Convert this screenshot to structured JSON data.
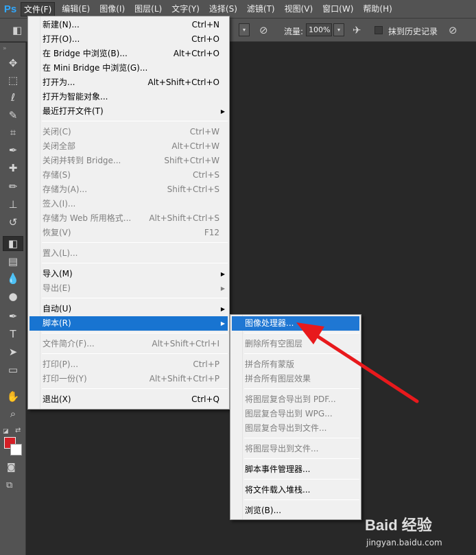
{
  "app": {
    "logo": "Ps"
  },
  "menubar": [
    {
      "label": "文件(F)",
      "active": true
    },
    {
      "label": "编辑(E)"
    },
    {
      "label": "图像(I)"
    },
    {
      "label": "图层(L)"
    },
    {
      "label": "文字(Y)"
    },
    {
      "label": "选择(S)"
    },
    {
      "label": "滤镜(T)"
    },
    {
      "label": "视图(V)"
    },
    {
      "label": "窗口(W)"
    },
    {
      "label": "帮助(H)"
    }
  ],
  "options_bar": {
    "flow_label": "流量:",
    "flow_value": "100%",
    "history_label": "抹到历史记录",
    "history_checked": false
  },
  "tools": {
    "grip": "»",
    "items": [
      {
        "name": "move-tool-icon",
        "glyph": "✥"
      },
      {
        "name": "marquee-tool-icon",
        "glyph": "⬚"
      },
      {
        "name": "lasso-tool-icon",
        "glyph": "ℓ"
      },
      {
        "name": "quick-select-tool-icon",
        "glyph": "✎"
      },
      {
        "name": "crop-tool-icon",
        "glyph": "⌗"
      },
      {
        "name": "eyedropper-tool-icon",
        "glyph": "✒"
      },
      {
        "name": "healing-brush-tool-icon",
        "glyph": "✚"
      },
      {
        "name": "brush-tool-icon",
        "glyph": "✏"
      },
      {
        "name": "clone-stamp-tool-icon",
        "glyph": "⊥"
      },
      {
        "name": "history-brush-tool-icon",
        "glyph": "↺"
      },
      {
        "name": "eraser-tool-icon",
        "glyph": "◧",
        "selected": true
      },
      {
        "name": "gradient-tool-icon",
        "glyph": "▤"
      },
      {
        "name": "blur-tool-icon",
        "glyph": "💧"
      },
      {
        "name": "dodge-tool-icon",
        "glyph": "●"
      },
      {
        "name": "pen-tool-icon",
        "glyph": "✒"
      },
      {
        "name": "type-tool-icon",
        "glyph": "T"
      },
      {
        "name": "path-select-tool-icon",
        "glyph": "➤"
      },
      {
        "name": "shape-tool-icon",
        "glyph": "▭"
      },
      {
        "name": "hand-tool-icon",
        "glyph": "✋"
      },
      {
        "name": "zoom-tool-icon",
        "glyph": "⌕"
      }
    ],
    "foreground_color": "#d41f26",
    "background_color": "#ffffff"
  },
  "file_menu": {
    "items": [
      {
        "label": "新建(N)...",
        "shortcut": "Ctrl+N"
      },
      {
        "label": "打开(O)...",
        "shortcut": "Ctrl+O"
      },
      {
        "label": "在 Bridge 中浏览(B)...",
        "shortcut": "Alt+Ctrl+O"
      },
      {
        "label": "在 Mini Bridge 中浏览(G)...",
        "shortcut": ""
      },
      {
        "label": "打开为...",
        "shortcut": "Alt+Shift+Ctrl+O"
      },
      {
        "label": "打开为智能对象...",
        "shortcut": ""
      },
      {
        "label": "最近打开文件(T)",
        "shortcut": "",
        "submenu": true
      },
      {
        "sep": true
      },
      {
        "label": "关闭(C)",
        "shortcut": "Ctrl+W",
        "disabled": true
      },
      {
        "label": "关闭全部",
        "shortcut": "Alt+Ctrl+W",
        "disabled": true
      },
      {
        "label": "关闭并转到 Bridge...",
        "shortcut": "Shift+Ctrl+W",
        "disabled": true
      },
      {
        "label": "存储(S)",
        "shortcut": "Ctrl+S",
        "disabled": true
      },
      {
        "label": "存储为(A)...",
        "shortcut": "Shift+Ctrl+S",
        "disabled": true
      },
      {
        "label": "签入(I)...",
        "shortcut": "",
        "disabled": true
      },
      {
        "label": "存储为 Web 所用格式...",
        "shortcut": "Alt+Shift+Ctrl+S",
        "disabled": true
      },
      {
        "label": "恢复(V)",
        "shortcut": "F12",
        "disabled": true
      },
      {
        "sep": true
      },
      {
        "label": "置入(L)...",
        "shortcut": "",
        "disabled": true
      },
      {
        "sep": true
      },
      {
        "label": "导入(M)",
        "shortcut": "",
        "submenu": true
      },
      {
        "label": "导出(E)",
        "shortcut": "",
        "submenu": true,
        "disabled": true
      },
      {
        "sep": true
      },
      {
        "label": "自动(U)",
        "shortcut": "",
        "submenu": true
      },
      {
        "label": "脚本(R)",
        "shortcut": "",
        "submenu": true,
        "highlighted": true
      },
      {
        "sep": true
      },
      {
        "label": "文件简介(F)...",
        "shortcut": "Alt+Shift+Ctrl+I",
        "disabled": true
      },
      {
        "sep": true
      },
      {
        "label": "打印(P)...",
        "shortcut": "Ctrl+P",
        "disabled": true
      },
      {
        "label": "打印一份(Y)",
        "shortcut": "Alt+Shift+Ctrl+P",
        "disabled": true
      },
      {
        "sep": true
      },
      {
        "label": "退出(X)",
        "shortcut": "Ctrl+Q"
      }
    ]
  },
  "script_menu": {
    "items": [
      {
        "label": "图像处理器...",
        "highlighted": true
      },
      {
        "sep": true
      },
      {
        "label": "删除所有空图层",
        "disabled": true
      },
      {
        "sep": true
      },
      {
        "label": "拼合所有蒙版",
        "disabled": true
      },
      {
        "label": "拼合所有图层效果",
        "disabled": true
      },
      {
        "sep": true
      },
      {
        "label": "将图层复合导出到 PDF...",
        "disabled": true
      },
      {
        "label": "图层复合导出到 WPG...",
        "disabled": true
      },
      {
        "label": "图层复合导出到文件...",
        "disabled": true
      },
      {
        "sep": true
      },
      {
        "label": "将图层导出到文件...",
        "disabled": true
      },
      {
        "sep": true
      },
      {
        "label": "脚本事件管理器..."
      },
      {
        "sep": true
      },
      {
        "label": "将文件载入堆栈..."
      },
      {
        "sep": true
      },
      {
        "label": "浏览(B)..."
      }
    ]
  },
  "annotation": {
    "arrow_color": "#e8191c"
  },
  "watermark": {
    "brand": "Baid 经验",
    "url": "jingyan.baidu.com"
  }
}
